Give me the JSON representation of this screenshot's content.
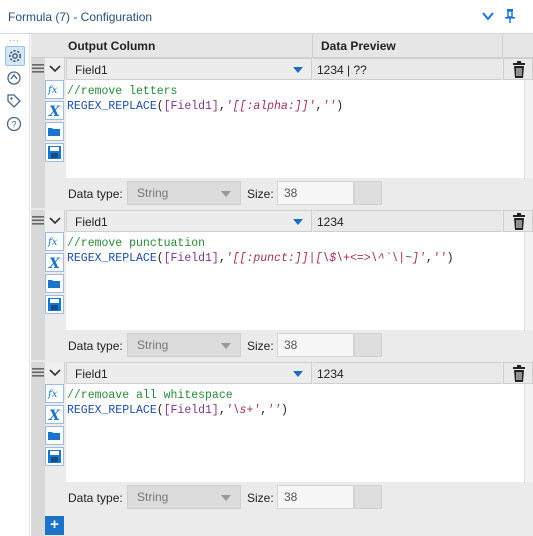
{
  "window": {
    "title": "Formula (7) - Configuration"
  },
  "columns": {
    "output": "Output Column",
    "preview": "Data Preview"
  },
  "formulas": [
    {
      "field": "Field1",
      "preview": "1234 | ??",
      "comment": "//remove letters",
      "code": {
        "fn": "REGEX_REPLACE",
        "field": "[Field1]",
        "pattern": "'[[:alpha:]]'",
        "replacement": "''"
      },
      "datatype_label": "Data type:",
      "datatype": "String",
      "size_label": "Size:",
      "size": "38"
    },
    {
      "field": "Field1",
      "preview": "1234",
      "comment": "//remove punctuation",
      "code": {
        "fn": "REGEX_REPLACE",
        "field": "[Field1]",
        "pattern": "'[[:punct:]]|[\\$\\+<=>\\^`\\|~]'",
        "replacement": "''"
      },
      "datatype_label": "Data type:",
      "datatype": "String",
      "size_label": "Size:",
      "size": "38"
    },
    {
      "field": "Field1",
      "preview": "1234",
      "comment": "//remoave all whitespace",
      "code": {
        "fn": "REGEX_REPLACE",
        "field": "[Field1]",
        "pattern": "'\\s+'",
        "replacement": "''"
      },
      "datatype_label": "Data type:",
      "datatype": "String",
      "size_label": "Size:",
      "size": "38"
    }
  ],
  "add_button": "+",
  "colors": {
    "accent": "#1b74c9",
    "comment": "#2a8a3a",
    "string": "#a0315a"
  }
}
